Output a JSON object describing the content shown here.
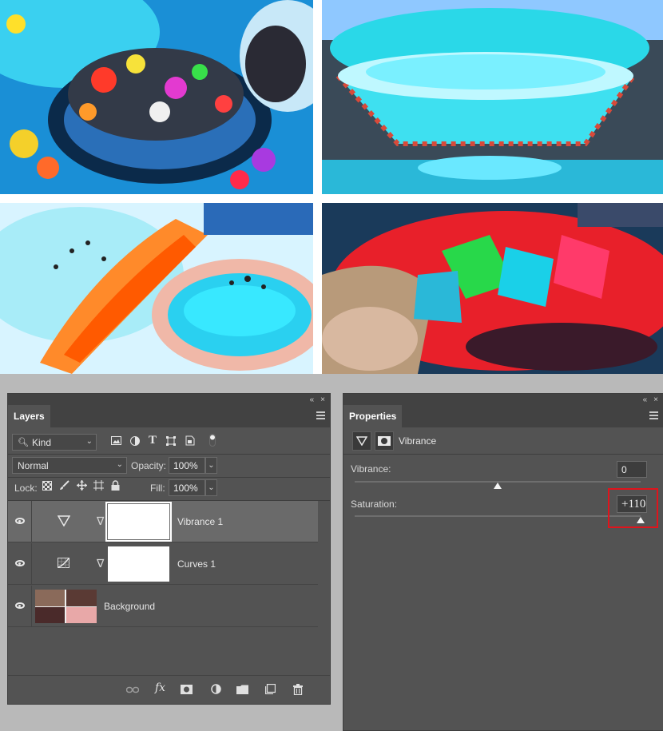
{
  "collage": {
    "photos": [
      {
        "id": "top-left",
        "subject": "candies"
      },
      {
        "id": "top-right",
        "subject": "cupcake"
      },
      {
        "id": "bottom-left",
        "subject": "macaron"
      },
      {
        "id": "bottom-right",
        "subject": "cake"
      }
    ]
  },
  "layers_panel": {
    "topbar": {
      "collapse": "«",
      "close": "×"
    },
    "tab": "Layers",
    "filter": {
      "label": "Kind",
      "icons": [
        "image-filter-icon",
        "adjustment-filter-icon",
        "type-filter-icon",
        "shape-filter-icon",
        "smart-object-filter-icon",
        "filter-toggle-icon"
      ]
    },
    "blend_mode": "Normal",
    "opacity_label": "Opacity:",
    "opacity_value": "100%",
    "lock_label": "Lock:",
    "fill_label": "Fill:",
    "fill_value": "100%",
    "layers": [
      {
        "name": "Vibrance 1",
        "type": "vibrance",
        "selected": true,
        "visible": true
      },
      {
        "name": "Curves 1",
        "type": "curves",
        "selected": false,
        "visible": true
      },
      {
        "name": "Background",
        "type": "pixel",
        "selected": false,
        "visible": true
      }
    ],
    "footer_icons": [
      "link-layers-icon",
      "fx-icon",
      "add-mask-icon",
      "new-adjustment-icon",
      "new-group-icon",
      "new-layer-icon",
      "delete-layer-icon"
    ],
    "footer_fx": "fx"
  },
  "properties_panel": {
    "topbar": {
      "collapse": "«",
      "close": "×"
    },
    "tab": "Properties",
    "adjustment_name": "Vibrance",
    "vibrance_label": "Vibrance:",
    "vibrance_value": "0",
    "vibrance_level": 0,
    "saturation_label": "Saturation:",
    "saturation_value": "+110",
    "saturation_level": 110
  },
  "colors": {
    "panel_bg": "#535353",
    "panel_header": "#424242",
    "selected_layer": "#6a6a6a",
    "highlight": "#e0141c"
  }
}
